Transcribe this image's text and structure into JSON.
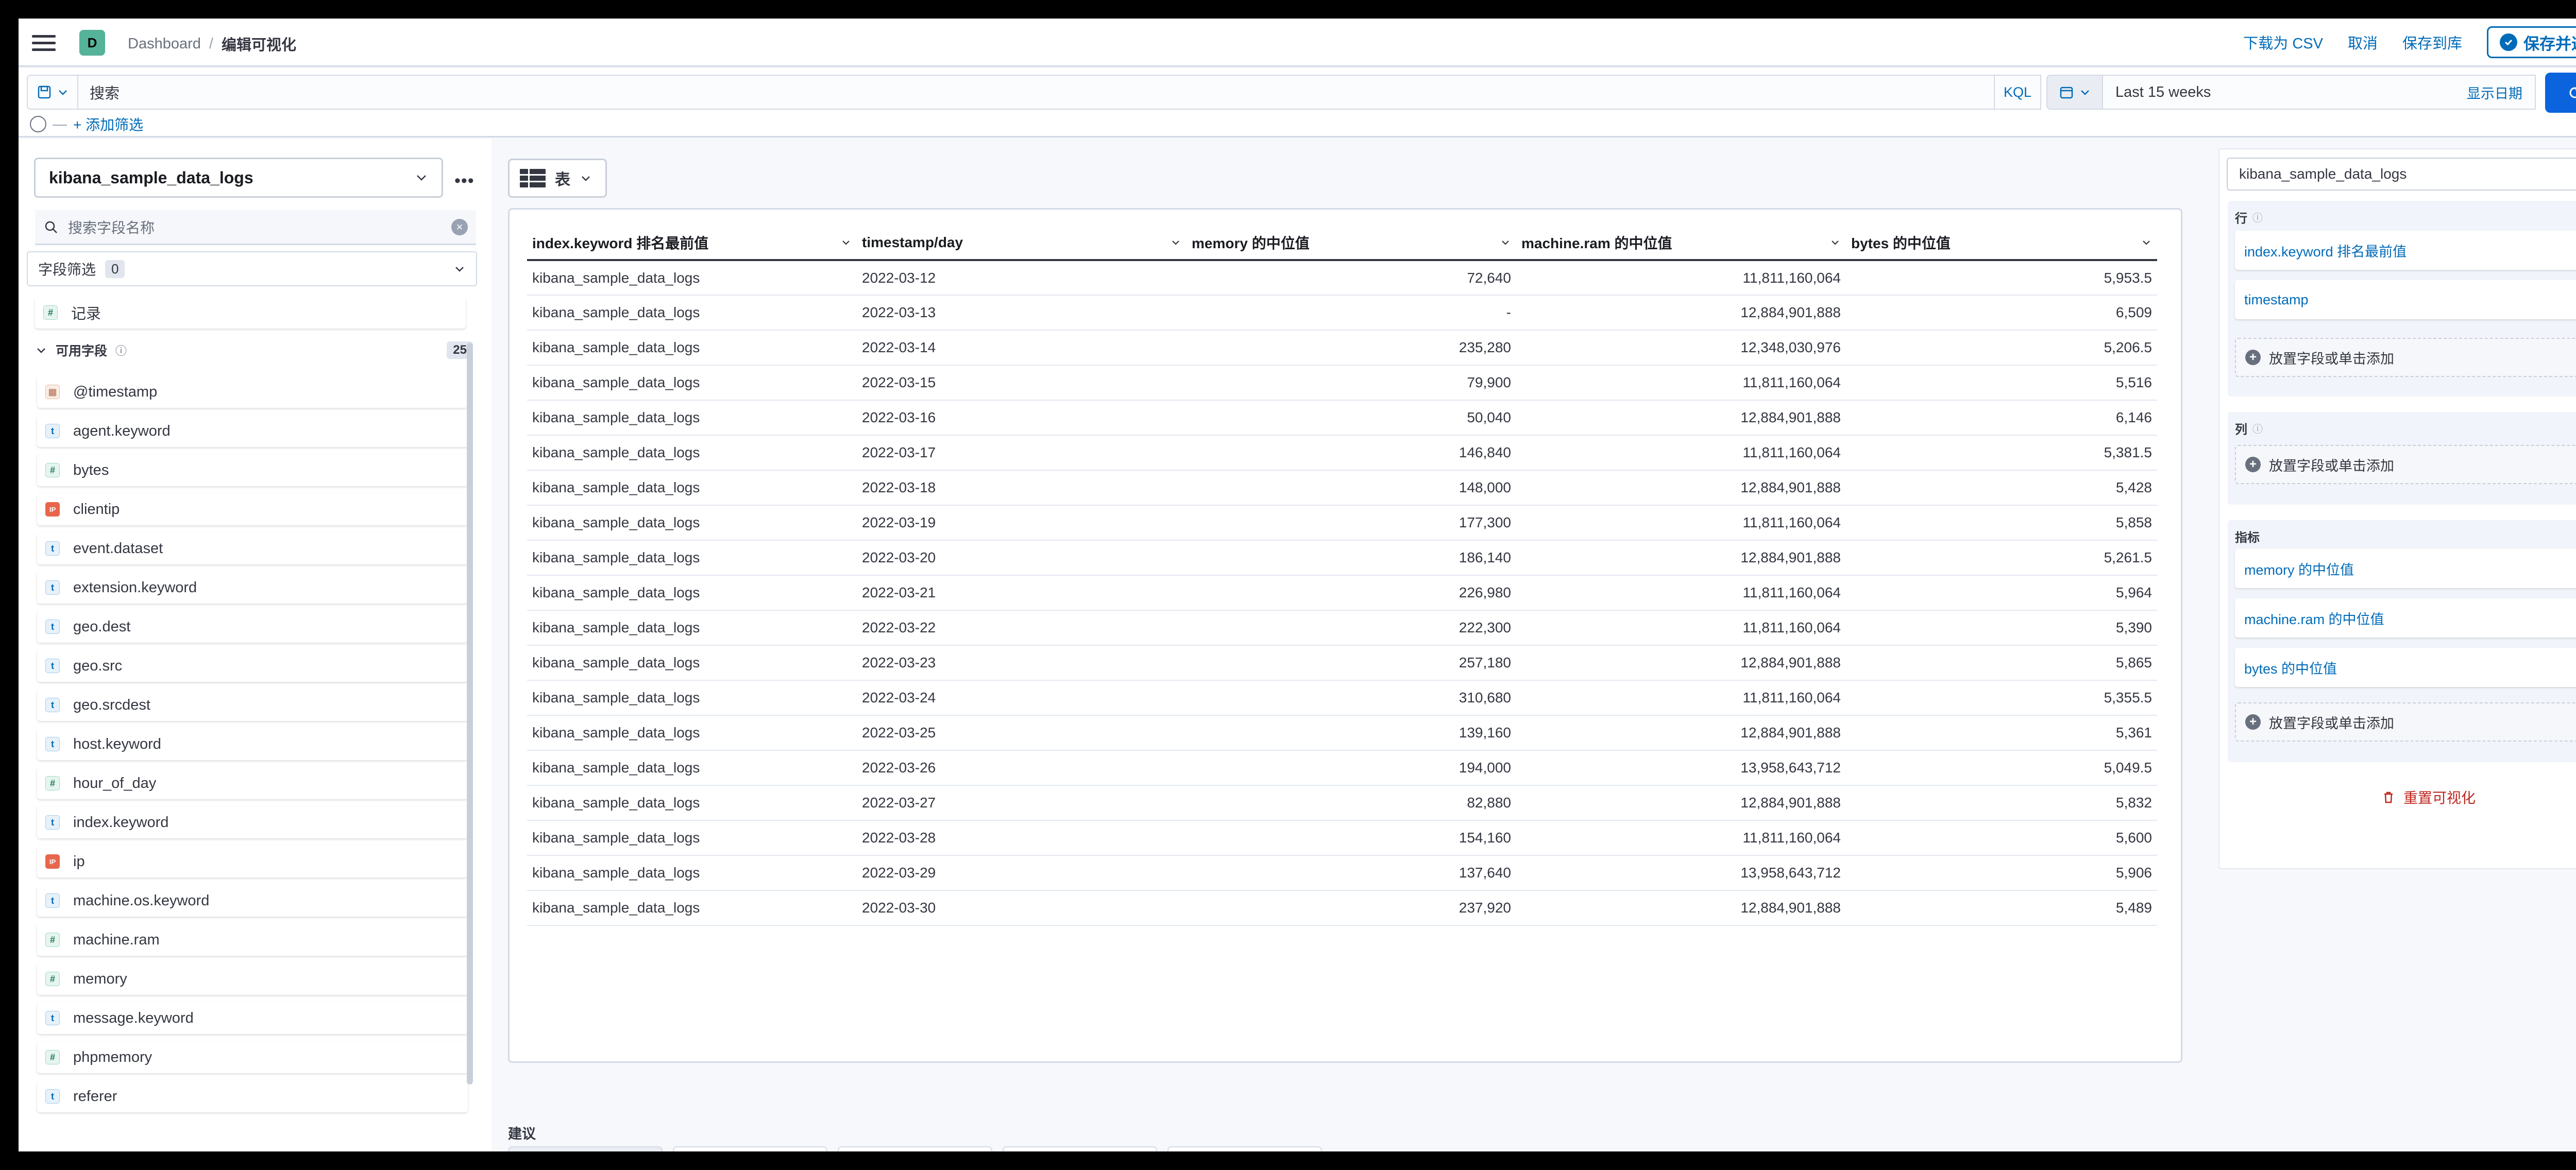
{
  "header": {
    "space_initial": "D",
    "breadcrumbs": [
      "Dashboard",
      "编辑可视化"
    ],
    "actions": [
      "下载为 CSV",
      "取消",
      "保存到库"
    ],
    "primary_action": "保存并返回"
  },
  "query_bar": {
    "search_placeholder": "搜索",
    "language": "KQL",
    "date_range": "Last 15 weeks",
    "show_dates": "显示日期",
    "refresh_label": "刷新",
    "add_filter": "+ 添加筛选"
  },
  "sidebar": {
    "index_pattern": "kibana_sample_data_logs",
    "options_glyph": "•••",
    "field_search_placeholder": "搜索字段名称",
    "field_filter_label": "字段筛选",
    "field_filter_count": "0",
    "records_label": "记录",
    "available_label": "可用字段",
    "available_count": "25",
    "fields": [
      {
        "name": "@timestamp",
        "type": "date",
        "glyph": "▦"
      },
      {
        "name": "agent.keyword",
        "type": "string",
        "glyph": "t"
      },
      {
        "name": "bytes",
        "type": "number",
        "glyph": "#"
      },
      {
        "name": "clientip",
        "type": "ip",
        "glyph": "IP"
      },
      {
        "name": "event.dataset",
        "type": "string",
        "glyph": "t"
      },
      {
        "name": "extension.keyword",
        "type": "string",
        "glyph": "t"
      },
      {
        "name": "geo.dest",
        "type": "string",
        "glyph": "t"
      },
      {
        "name": "geo.src",
        "type": "string",
        "glyph": "t"
      },
      {
        "name": "geo.srcdest",
        "type": "string",
        "glyph": "t"
      },
      {
        "name": "host.keyword",
        "type": "string",
        "glyph": "t"
      },
      {
        "name": "hour_of_day",
        "type": "number",
        "glyph": "#"
      },
      {
        "name": "index.keyword",
        "type": "string",
        "glyph": "t"
      },
      {
        "name": "ip",
        "type": "ip",
        "glyph": "IP"
      },
      {
        "name": "machine.os.keyword",
        "type": "string",
        "glyph": "t"
      },
      {
        "name": "machine.ram",
        "type": "number",
        "glyph": "#"
      },
      {
        "name": "memory",
        "type": "number",
        "glyph": "#"
      },
      {
        "name": "message.keyword",
        "type": "string",
        "glyph": "t"
      },
      {
        "name": "phpmemory",
        "type": "number",
        "glyph": "#"
      },
      {
        "name": "referer",
        "type": "string",
        "glyph": "t"
      }
    ]
  },
  "workspace": {
    "vis_type": "表",
    "suggestions_label": "建议",
    "table": {
      "headers": [
        "index.keyword 排名最前值",
        "timestamp/day",
        "memory 的中位值",
        "machine.ram 的中位值",
        "bytes 的中位值"
      ],
      "rows": [
        [
          "kibana_sample_data_logs",
          "2022-03-12",
          "72,640",
          "11,811,160,064",
          "5,953.5"
        ],
        [
          "kibana_sample_data_logs",
          "2022-03-13",
          "-",
          "12,884,901,888",
          "6,509"
        ],
        [
          "kibana_sample_data_logs",
          "2022-03-14",
          "235,280",
          "12,348,030,976",
          "5,206.5"
        ],
        [
          "kibana_sample_data_logs",
          "2022-03-15",
          "79,900",
          "11,811,160,064",
          "5,516"
        ],
        [
          "kibana_sample_data_logs",
          "2022-03-16",
          "50,040",
          "12,884,901,888",
          "6,146"
        ],
        [
          "kibana_sample_data_logs",
          "2022-03-17",
          "146,840",
          "11,811,160,064",
          "5,381.5"
        ],
        [
          "kibana_sample_data_logs",
          "2022-03-18",
          "148,000",
          "12,884,901,888",
          "5,428"
        ],
        [
          "kibana_sample_data_logs",
          "2022-03-19",
          "177,300",
          "11,811,160,064",
          "5,858"
        ],
        [
          "kibana_sample_data_logs",
          "2022-03-20",
          "186,140",
          "12,884,901,888",
          "5,261.5"
        ],
        [
          "kibana_sample_data_logs",
          "2022-03-21",
          "226,980",
          "11,811,160,064",
          "5,964"
        ],
        [
          "kibana_sample_data_logs",
          "2022-03-22",
          "222,300",
          "11,811,160,064",
          "5,390"
        ],
        [
          "kibana_sample_data_logs",
          "2022-03-23",
          "257,180",
          "12,884,901,888",
          "5,865"
        ],
        [
          "kibana_sample_data_logs",
          "2022-03-24",
          "310,680",
          "11,811,160,064",
          "5,355.5"
        ],
        [
          "kibana_sample_data_logs",
          "2022-03-25",
          "139,160",
          "12,884,901,888",
          "5,361"
        ],
        [
          "kibana_sample_data_logs",
          "2022-03-26",
          "194,000",
          "13,958,643,712",
          "5,049.5"
        ],
        [
          "kibana_sample_data_logs",
          "2022-03-27",
          "82,880",
          "12,884,901,888",
          "5,832"
        ],
        [
          "kibana_sample_data_logs",
          "2022-03-28",
          "154,160",
          "11,811,160,064",
          "5,600"
        ],
        [
          "kibana_sample_data_logs",
          "2022-03-29",
          "137,640",
          "13,958,643,712",
          "5,906"
        ],
        [
          "kibana_sample_data_logs",
          "2022-03-30",
          "237,920",
          "12,884,901,888",
          "5,489"
        ]
      ]
    }
  },
  "config_panel": {
    "index_pattern": "kibana_sample_data_logs",
    "rows_label": "行",
    "rows_fields": [
      "index.keyword 排名最前值",
      "timestamp"
    ],
    "columns_label": "列",
    "metrics_label": "指标",
    "metrics_fields": [
      "memory 的中位值",
      "machine.ram 的中位值",
      "bytes 的中位值"
    ],
    "drop_placeholder": "放置字段或单击添加",
    "remove_glyph": "×",
    "reset_label": "重置可视化"
  },
  "colors": {
    "accent": "#006bb8",
    "primary_button": "#0b64dd",
    "danger": "#bd271e",
    "space_avatar": "#54b399"
  }
}
